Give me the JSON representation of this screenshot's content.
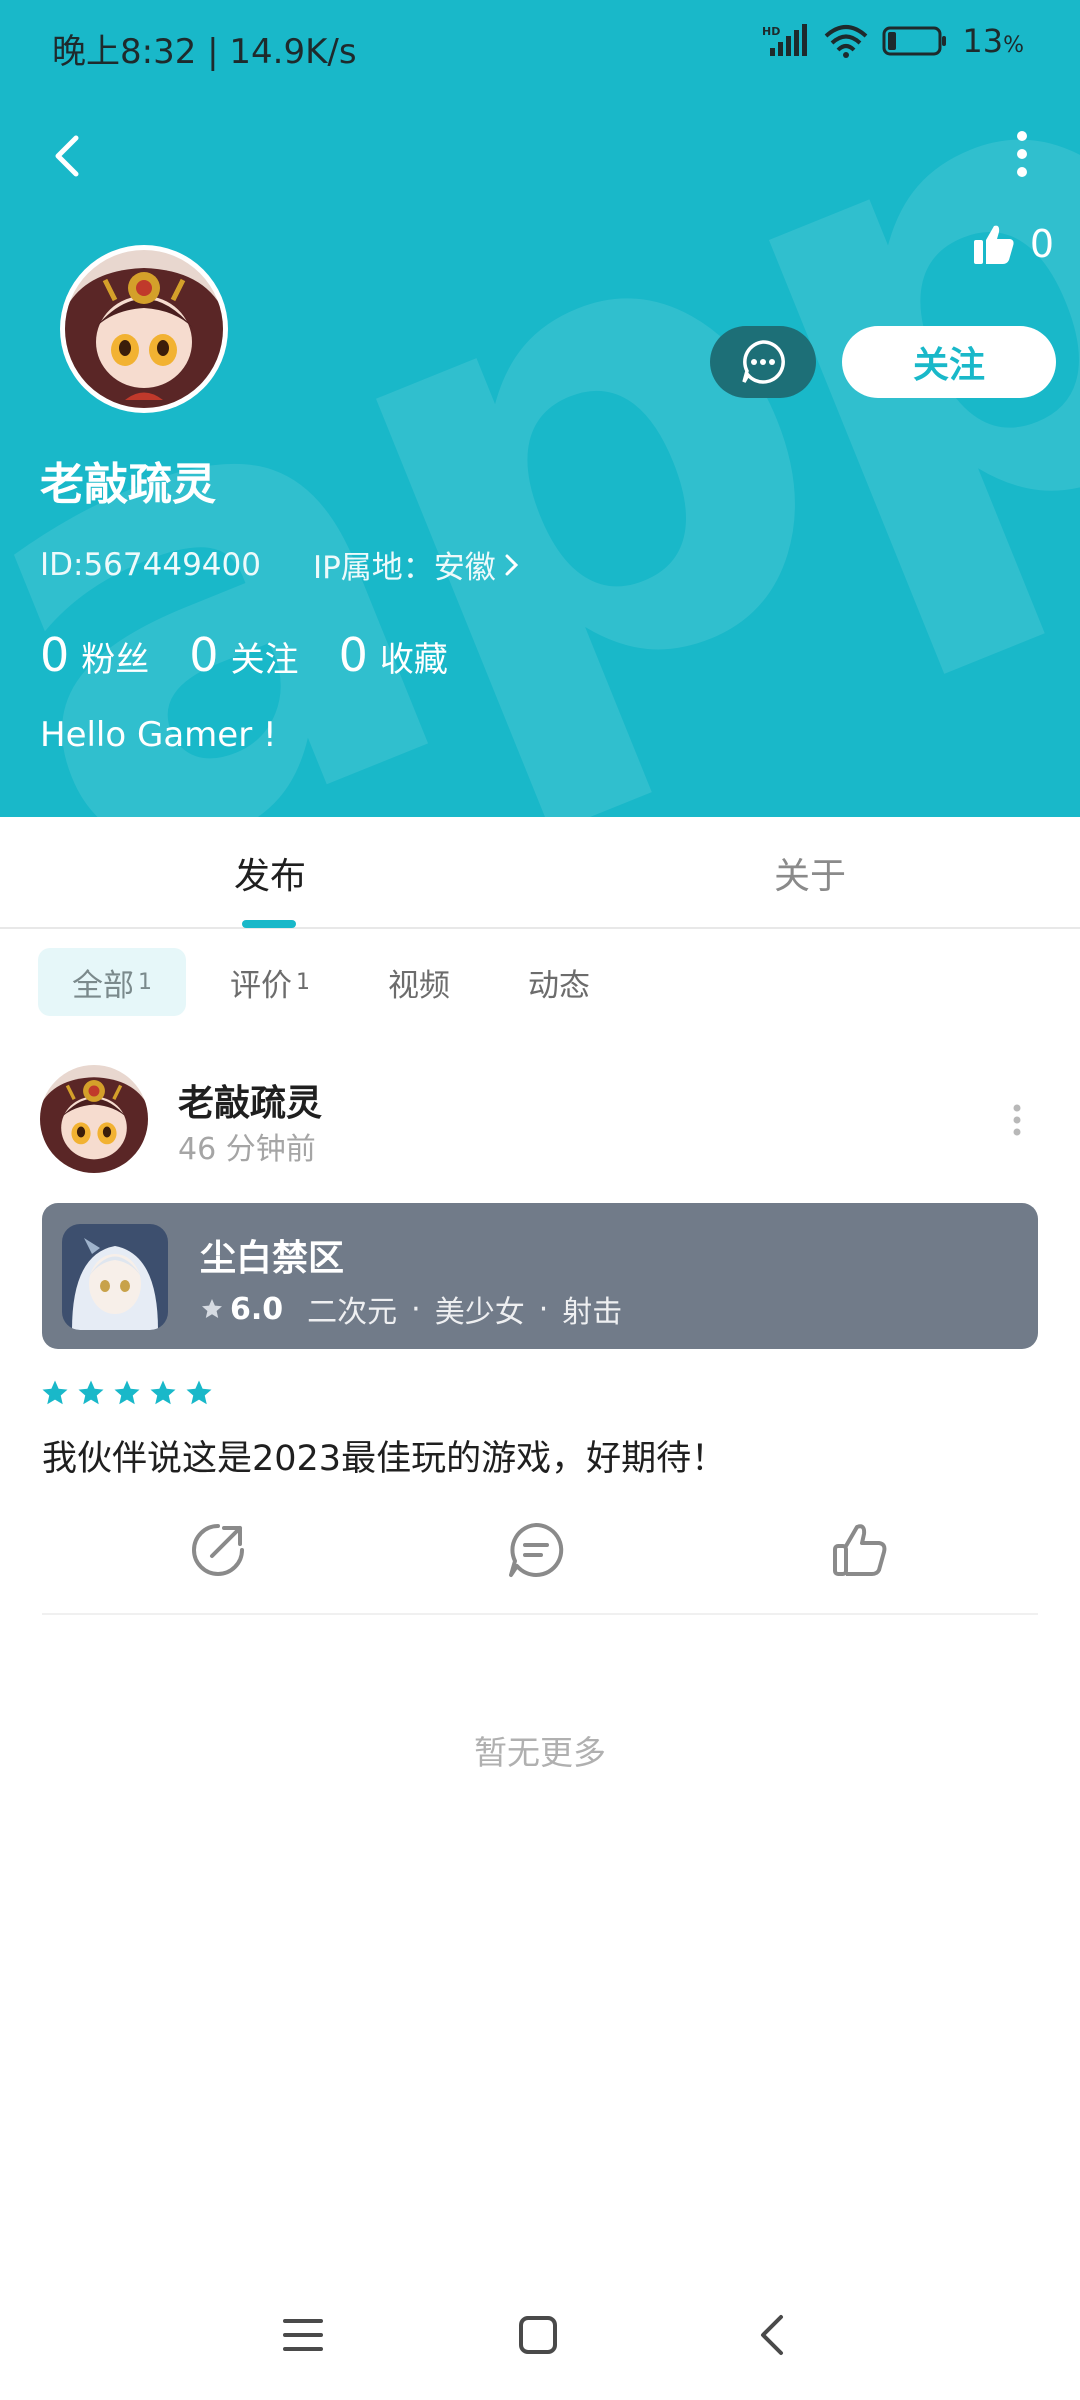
{
  "status_bar": {
    "time": "晚上8:32 | 14.9K/s",
    "battery": "13",
    "battery_unit": "%"
  },
  "profile": {
    "likes": "0",
    "follow_label": "关注",
    "username": "老敲疏灵",
    "id_text": "ID:567449400",
    "ip_text": "IP属地：安徽",
    "stats": [
      {
        "num": "0",
        "label": "粉丝"
      },
      {
        "num": "0",
        "label": "关注"
      },
      {
        "num": "0",
        "label": "收藏"
      }
    ],
    "bio": "Hello Gamer !"
  },
  "tabs": [
    {
      "label": "发布",
      "active": true
    },
    {
      "label": "关于",
      "active": false
    }
  ],
  "filters": [
    {
      "label": "全部",
      "count": "1",
      "active": true
    },
    {
      "label": "评价",
      "count": "1",
      "active": false
    },
    {
      "label": "视频",
      "count": "",
      "active": false
    },
    {
      "label": "动态",
      "count": "",
      "active": false
    }
  ],
  "post": {
    "author": "老敲疏灵",
    "time": "46 分钟前",
    "game": {
      "name": "尘白禁区",
      "rating": "6.0",
      "tags": [
        "二次元",
        "美少女",
        "射击"
      ]
    },
    "stars": 5,
    "text": "我伙伴说这是2023最佳玩的游戏，好期待！"
  },
  "footer": {
    "no_more": "暂无更多"
  },
  "colors": {
    "accent": "#19b8c9",
    "card_bg": "#717b89",
    "msg_btn": "#1d6f77"
  }
}
